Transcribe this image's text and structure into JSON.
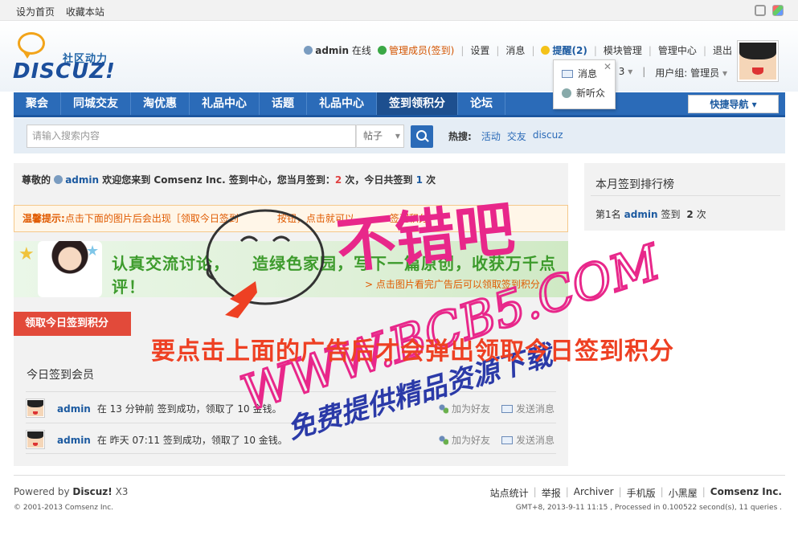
{
  "topbar": {
    "set_home": "设为首页",
    "bookmark": "收藏本站"
  },
  "logo": {
    "tagline": "社区动力",
    "wordmark": "DISCUZ!"
  },
  "userbar": {
    "username": "admin",
    "online": "在线",
    "manager_status": "管理成员(签到)",
    "settings": "设置",
    "messages": "消息",
    "remind": "提醒(2)",
    "module_manage": "模块管理",
    "admin_center": "管理中心",
    "logout": "退出",
    "count_partial": "3",
    "user_group": "用户组: 管理员"
  },
  "popup": {
    "item1": "消息",
    "item2": "新听众"
  },
  "nav": {
    "items": [
      "聚会",
      "同城交友",
      "淘优惠",
      "礼品中心",
      "话题",
      "礼品中心",
      "签到领积分",
      "论坛"
    ],
    "active_index": 6,
    "quick": "快捷导航"
  },
  "search": {
    "placeholder": "请输入搜索内容",
    "type": "帖子",
    "hot_label": "热搜:",
    "hot": [
      "活动",
      "交友",
      "discuz"
    ]
  },
  "main": {
    "welcome_a": "尊敬的",
    "welcome_user": "admin",
    "welcome_b": "欢迎您来到 Comsenz Inc. 签到中心，您当月签到：",
    "month_count": "2",
    "welcome_c": "次，今日共签到",
    "today_count": "1",
    "welcome_d": "次",
    "tip_label": "温馨提示:",
    "tip_text": "点击下面的图片后会出现［领取今日签到",
    "tip_text2": "按钮，点击就可以",
    "tip_text3": "签到积分!",
    "banner_headline": "认真交流讨论，",
    "banner_headline2": "造绿色家园，写下一篇原创，收获万千点评！",
    "banner_sub": "> 点击图片看完广告后可以领取签到积分",
    "claim_button": "领取今日签到积分",
    "members_title": "今日签到会员",
    "members": [
      {
        "name": "admin",
        "text": "在 13 分钟前 签到成功，领取了 10 金钱。",
        "add_friend": "加为好友",
        "send_msg": "发送消息"
      },
      {
        "name": "admin",
        "text": "在 昨天 07:11 签到成功，领取了 10 金钱。",
        "add_friend": "加为好友",
        "send_msg": "发送消息"
      }
    ]
  },
  "side": {
    "title": "本月签到排行榜",
    "rank_label": "第1名",
    "rank_user": "admin",
    "rank_text": "签到",
    "rank_count": "2",
    "rank_unit": "次"
  },
  "footer": {
    "powered_pre": "Powered by",
    "powered_brand": "Discuz!",
    "powered_ver": "X3",
    "copyright": "© 2001-2013 Comsenz Inc.",
    "links": [
      "站点统计",
      "举报",
      "Archiver",
      "手机版",
      "小黑屋"
    ],
    "brand": "Comsenz Inc.",
    "stats": "GMT+8, 2013-9-11 11:15 , Processed in 0.100522 second(s), 11 queries ."
  },
  "watermark": {
    "title": "不错吧",
    "url": "WWW.BCB5.COM",
    "note": "要点击上面的广告后才会弹出领取今日签到积分",
    "tagline": "免费提供精品资源下载"
  },
  "colors": {
    "nav_blue": "#2b6bb8",
    "claim_red": "#e24a3a",
    "watermark_pink": "#e8278a",
    "note_red": "#ee4023"
  }
}
